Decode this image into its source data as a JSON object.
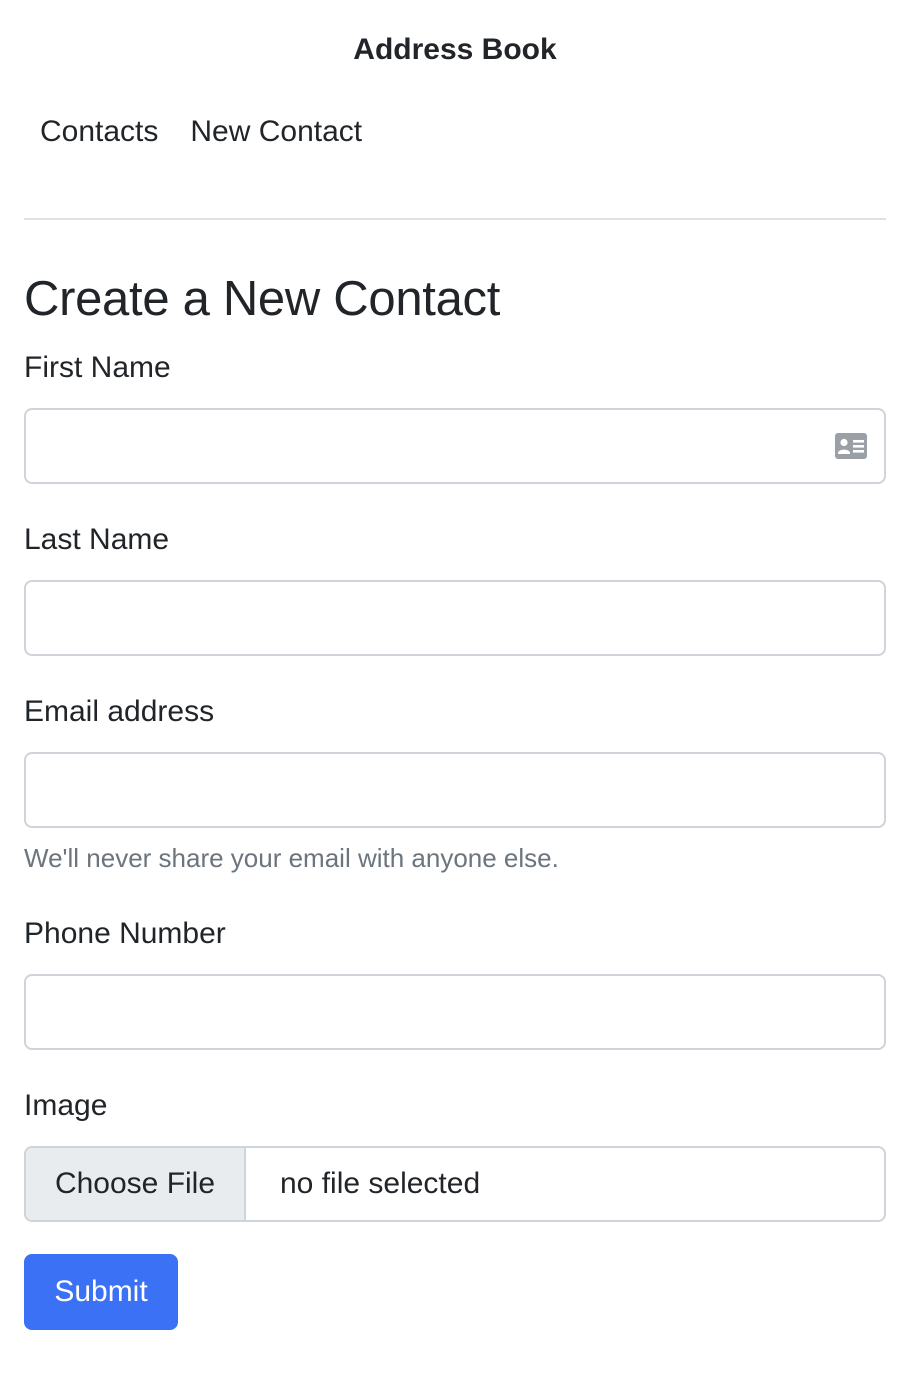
{
  "header": {
    "title": "Address Book"
  },
  "nav": {
    "items": [
      {
        "label": "Contacts"
      },
      {
        "label": "New Contact"
      }
    ]
  },
  "page": {
    "title": "Create a New Contact"
  },
  "form": {
    "first_name": {
      "label": "First Name",
      "value": "",
      "icon": "contact-card-icon"
    },
    "last_name": {
      "label": "Last Name",
      "value": ""
    },
    "email": {
      "label": "Email address",
      "value": "",
      "help": "We'll never share your email with anyone else."
    },
    "phone": {
      "label": "Phone Number",
      "value": ""
    },
    "image": {
      "label": "Image",
      "button_label": "Choose File",
      "status": "no file selected"
    },
    "submit_label": "Submit"
  },
  "colors": {
    "primary": "#3b71f5",
    "border": "#ced4da",
    "muted_text": "#6c757d",
    "file_button_bg": "#e9ecef"
  }
}
